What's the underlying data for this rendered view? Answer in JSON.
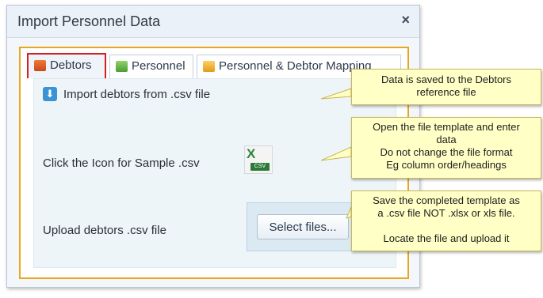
{
  "dialog": {
    "title": "Import Personnel Data",
    "close_glyph": "×"
  },
  "tabs": [
    {
      "label": "Debtors",
      "icon": "spreadsheet-red-icon",
      "selected": true
    },
    {
      "label": "Personnel",
      "icon": "spreadsheet-green-icon",
      "selected": false
    },
    {
      "label": "Personnel & Debtor Mapping",
      "icon": "spreadsheet-yellow-icon",
      "selected": false
    }
  ],
  "panel": {
    "import_label": "Import debtors from .csv file",
    "sample_label": "Click the Icon for Sample .csv",
    "csv_badge": "CSV",
    "csv_letter": "X",
    "upload_label": "Upload debtors .csv file",
    "select_files_label": "Select files..."
  },
  "callouts": {
    "c1": [
      "Data is saved to the Debtors",
      "reference file"
    ],
    "c2": [
      "Open the file template and enter",
      "data",
      "Do not change the file format",
      "Eg column order/headings"
    ],
    "c3": [
      "Save the completed template as",
      "a .csv file NOT .xlsx or xls file.",
      "",
      "Locate the file and upload it"
    ]
  },
  "colors": {
    "frame_border": "#e7a81f",
    "selected_tab_border": "#d21f1f",
    "callout_bg": "#ffffc6"
  }
}
